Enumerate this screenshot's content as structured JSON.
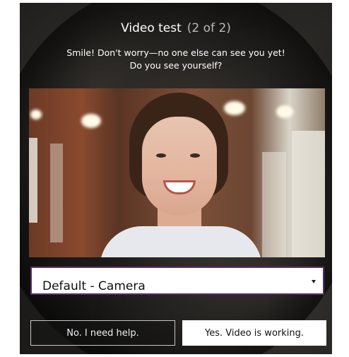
{
  "dialog": {
    "title": "Video test",
    "step": "(2 of 2)",
    "subtitle_line1": "Smile! Don't worry—no one else can see you yet!",
    "subtitle_line2": "Do you see yourself?"
  },
  "camera_select": {
    "value": "Default - Camera",
    "icon": "chevron-down-icon"
  },
  "buttons": {
    "no_label": "No. I need help.",
    "yes_label": "Yes. Video is working."
  }
}
